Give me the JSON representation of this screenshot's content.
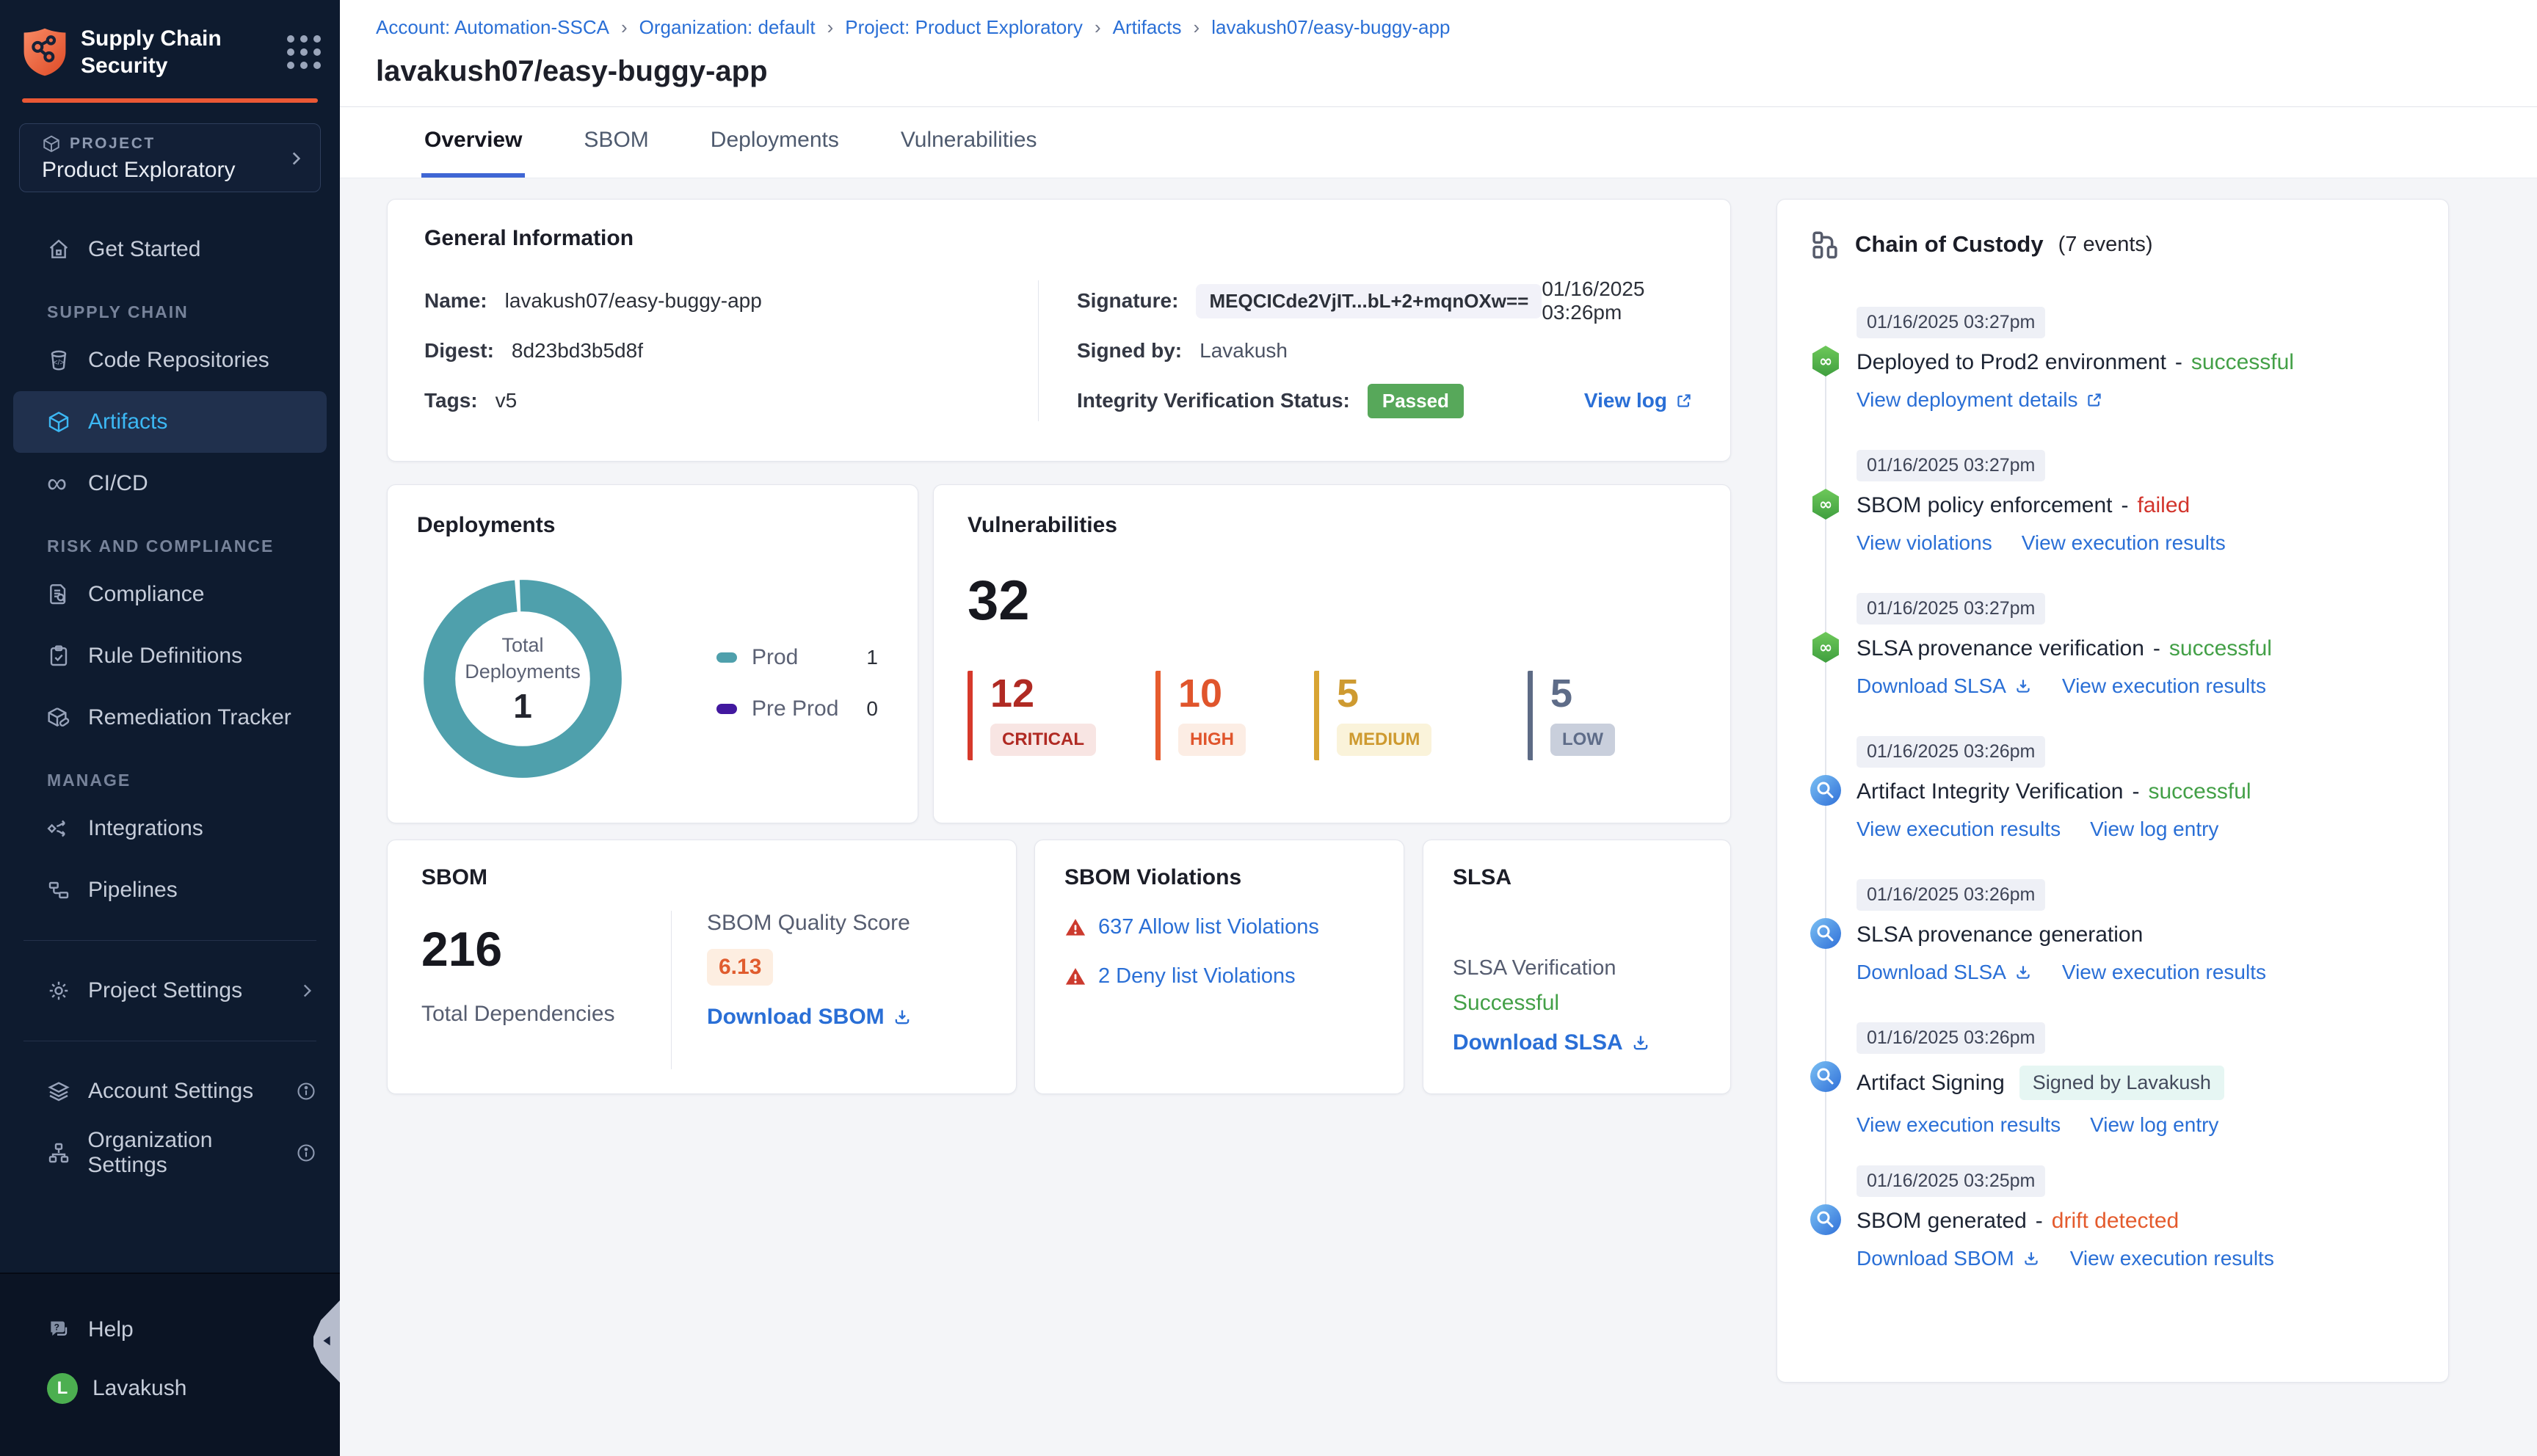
{
  "colors": {
    "green": "#43a047",
    "red": "#d2342c",
    "orange": "#e45b2d",
    "teal": "#4FA0AC",
    "purple": "#42189F",
    "link_blue": "#2A6FD6",
    "accent_orange": "#EA5835"
  },
  "sidebar": {
    "app_title": "Supply Chain Security",
    "project_label": "PROJECT",
    "project_name": "Product Exploratory",
    "items": {
      "get_started": "Get Started",
      "code_repositories": "Code Repositories",
      "artifacts": "Artifacts",
      "cicd": "CI/CD",
      "compliance": "Compliance",
      "rule_definitions": "Rule Definitions",
      "remediation_tracker": "Remediation Tracker",
      "integrations": "Integrations",
      "pipelines": "Pipelines",
      "project_settings": "Project Settings",
      "account_settings": "Account Settings",
      "organization_settings": "Organization Settings",
      "help": "Help"
    },
    "sections": {
      "supply_chain": "SUPPLY CHAIN",
      "risk": "RISK AND COMPLIANCE",
      "manage": "MANAGE"
    },
    "user": {
      "name": "Lavakush",
      "initial": "L"
    }
  },
  "header": {
    "breadcrumb": [
      "Account: Automation-SSCA",
      "Organization: default",
      "Project: Product Exploratory",
      "Artifacts",
      "lavakush07/easy-buggy-app"
    ],
    "title": "lavakush07/easy-buggy-app"
  },
  "tabs": [
    {
      "label": "Overview"
    },
    {
      "label": "SBOM"
    },
    {
      "label": "Deployments"
    },
    {
      "label": "Vulnerabilities"
    }
  ],
  "general_info": {
    "title": "General Information",
    "name_label": "Name:",
    "name": "lavakush07/easy-buggy-app",
    "digest_label": "Digest:",
    "digest": "8d23bd3b5d8f",
    "tags_label": "Tags:",
    "tags": "v5",
    "signature_label": "Signature:",
    "signature": "MEQCICde2VjIT...bL+2+mqnOXw==",
    "signature_time": "01/16/2025 03:26pm",
    "signed_by_label": "Signed by:",
    "signed_by": "Lavakush",
    "integrity_label": "Integrity Verification Status:",
    "integrity_status": "Passed",
    "view_log": "View log"
  },
  "deployments": {
    "title": "Deployments",
    "center_label": "Total Deployments",
    "total": "1",
    "legend": [
      {
        "label": "Prod",
        "value": "1",
        "color": "#4FA0AC"
      },
      {
        "label": "Pre Prod",
        "value": "0",
        "color": "#42189F"
      }
    ],
    "chart_data": {
      "type": "pie",
      "categories": [
        "Prod",
        "Pre Prod"
      ],
      "values": [
        1,
        0
      ],
      "title": "Total Deployments"
    }
  },
  "vulnerabilities": {
    "title": "Vulnerabilities",
    "total": "32",
    "severities": [
      {
        "label": "CRITICAL",
        "value": "12",
        "color": "#B02A23",
        "bar": "#D6392B",
        "badge_bg": "#F8E5E3"
      },
      {
        "label": "HIGH",
        "value": "10",
        "color": "#E0552C",
        "bar": "#E65C2E",
        "badge_bg": "#FCEDE4"
      },
      {
        "label": "MEDIUM",
        "value": "5",
        "color": "#CE9A30",
        "bar": "#D8A433",
        "badge_bg": "#FAF3DA"
      },
      {
        "label": "LOW",
        "value": "5",
        "color": "#5E6C88",
        "bar": "#5D6B85",
        "badge_bg": "#C9CFDC"
      }
    ]
  },
  "sbom": {
    "title": "SBOM",
    "total": "216",
    "total_label": "Total Dependencies",
    "quality_label": "SBOM Quality Score",
    "quality_score": "6.13",
    "download": "Download SBOM"
  },
  "sbom_violations": {
    "title": "SBOM Violations",
    "allow": "637 Allow list Violations",
    "deny": "2 Deny list Violations"
  },
  "slsa": {
    "title": "SLSA",
    "verification_label": "SLSA Verification",
    "status": "Successful",
    "download": "Download SLSA"
  },
  "chain_of_custody": {
    "title": "Chain of Custody",
    "events_count": "(7 events)",
    "sep": "-",
    "events": [
      {
        "time": "01/16/2025 03:27pm",
        "title": "Deployed to Prod2 environment",
        "status": "successful",
        "link1": "View deployment details",
        "link2": ""
      },
      {
        "time": "01/16/2025 03:27pm",
        "title": "SBOM policy enforcement",
        "status": "failed",
        "link1": "View violations",
        "link2": "View execution results"
      },
      {
        "time": "01/16/2025 03:27pm",
        "title": "SLSA provenance verification",
        "status": "successful",
        "link1": "Download SLSA",
        "link2": "View execution results"
      },
      {
        "time": "01/16/2025 03:26pm",
        "title": "Artifact Integrity Verification",
        "status": "successful",
        "link1": "View execution results",
        "link2": "View log entry"
      },
      {
        "time": "01/16/2025 03:26pm",
        "title": "SLSA provenance generation",
        "status": "",
        "link1": "Download SLSA",
        "link2": "View execution results"
      },
      {
        "time": "01/16/2025 03:26pm",
        "title": "Artifact Signing",
        "status": "",
        "badge": "Signed by Lavakush",
        "link1": "View execution results",
        "link2": "View log entry"
      },
      {
        "time": "01/16/2025 03:25pm",
        "title": "SBOM generated",
        "status": "drift detected",
        "link1": "Download SBOM",
        "link2": "View execution results"
      }
    ]
  }
}
